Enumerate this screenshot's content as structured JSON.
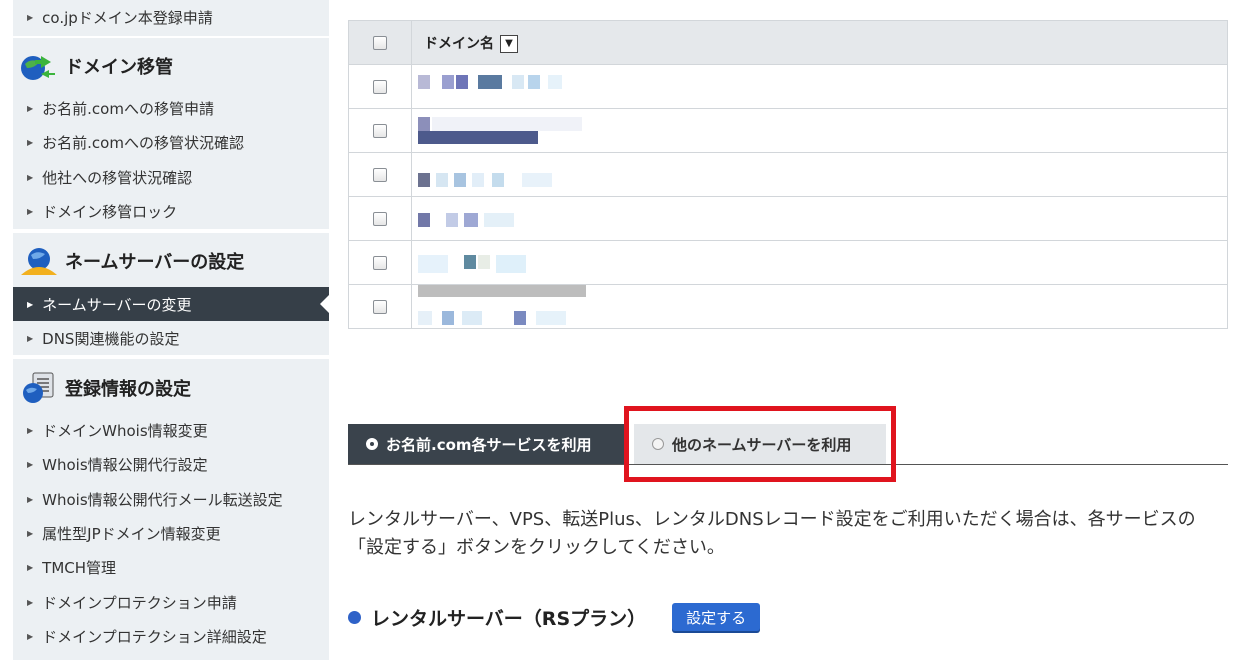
{
  "sidebar": {
    "top_item": "co.jpドメイン本登録申請",
    "transfer": {
      "heading": "ドメイン移管",
      "items": [
        "お名前.comへの移管申請",
        "お名前.comへの移管状況確認",
        "他社への移管状況確認",
        "ドメイン移管ロック"
      ]
    },
    "nameserver": {
      "heading": "ネームサーバーの設定",
      "items": [
        "ネームサーバーの変更",
        "DNS関連機能の設定"
      ]
    },
    "registration": {
      "heading": "登録情報の設定",
      "items": [
        "ドメインWhois情報変更",
        "Whois情報公開代行設定",
        "Whois情報公開代行メール転送設定",
        "属性型JPドメイン情報変更",
        "TMCH管理",
        "ドメインプロテクション申請",
        "ドメインプロテクション詳細設定"
      ]
    }
  },
  "table": {
    "header": "ドメイン名",
    "sort_glyph": "▼"
  },
  "tabs": {
    "active": "お名前.com各サービスを利用",
    "inactive": "他のネームサーバーを利用"
  },
  "description": "レンタルサーバー、VPS、転送Plus、レンタルDNSレコード設定をご利用いただく場合は、各サービスの「設定する」ボタンをクリックしてください。",
  "service": {
    "title": "レンタルサーバー（RSプラン）",
    "button": "設定する"
  },
  "colors": {
    "sidebar_bg": "#ecf0f3",
    "active_nav": "#363f48",
    "highlight": "#e0141e",
    "button": "#2c6ad1"
  }
}
